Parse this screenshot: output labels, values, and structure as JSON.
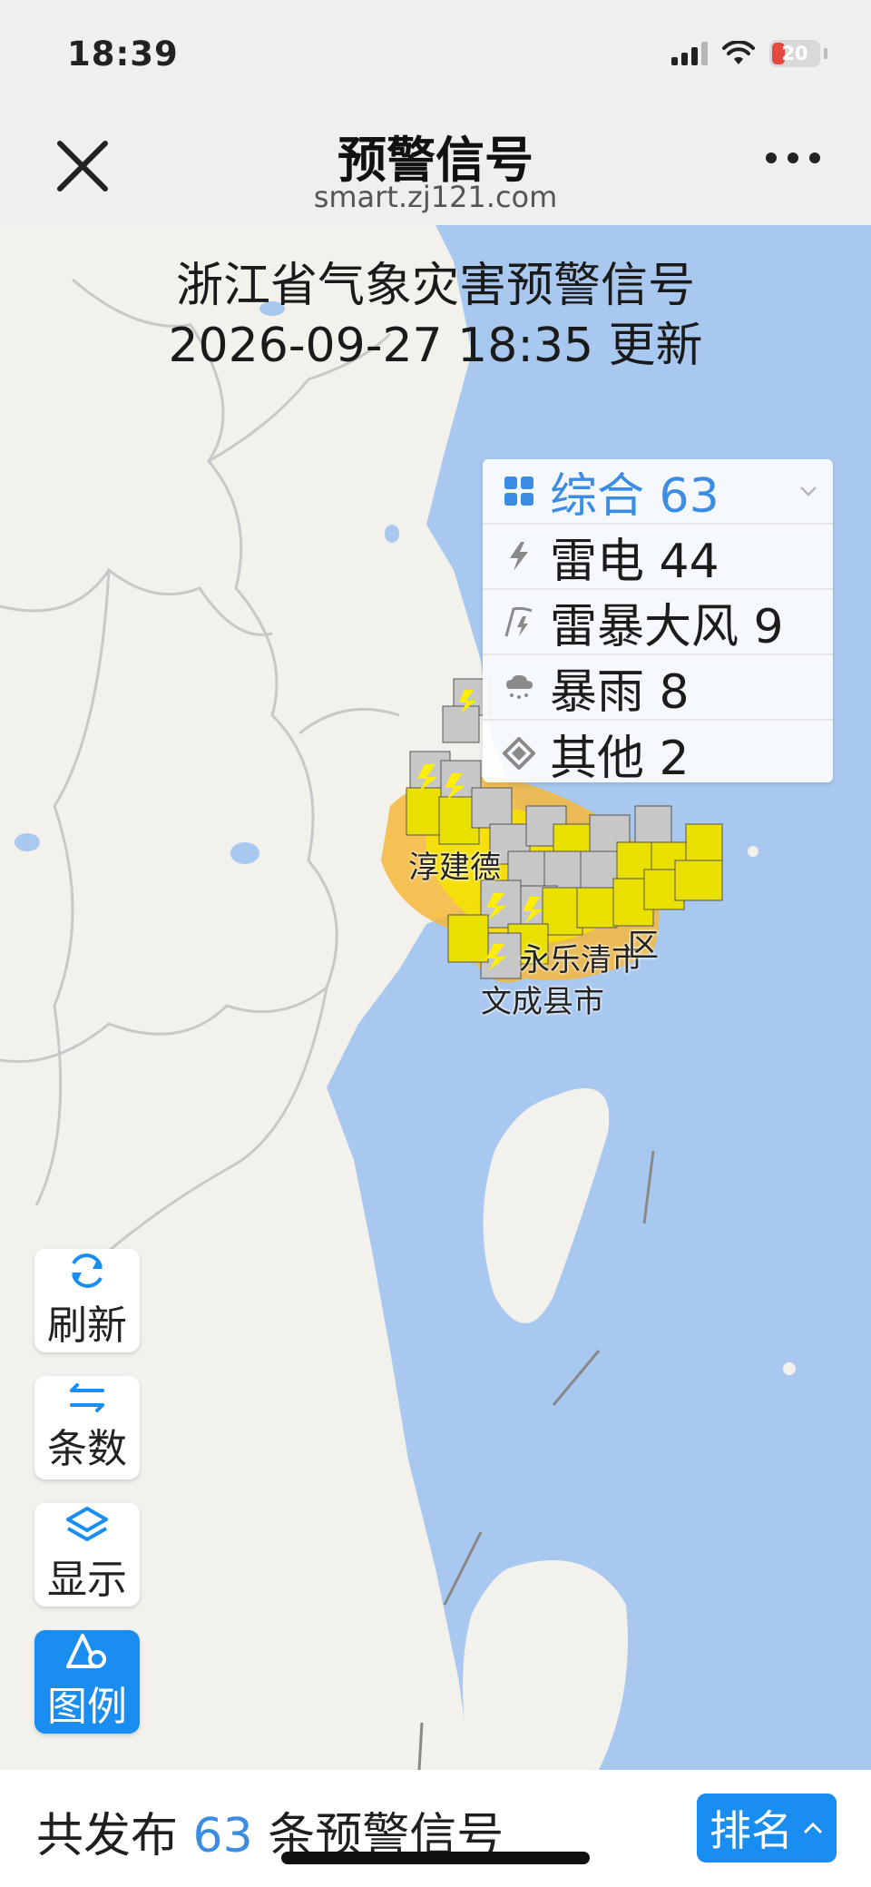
{
  "status_bar": {
    "time": "18:39",
    "battery": "20"
  },
  "nav": {
    "title": "预警信号",
    "subtitle": "smart.zj121.com"
  },
  "map": {
    "title_line1": "浙江省气象灾害预警信号",
    "title_line2": "2026-09-27 18:35 更新",
    "places": [
      "淳建德",
      "永乐清市",
      "文成县市",
      "区"
    ],
    "colors": {
      "land": "#f3f1ec",
      "sea": "#a9c8ef",
      "border": "#c8c8c8",
      "warning_yellow": "#f5e400",
      "warning_orange": "#f4b73a"
    }
  },
  "warning_types": [
    {
      "icon": "grid-icon",
      "label": "综合 63",
      "active": true
    },
    {
      "icon": "lightning-icon",
      "label": "雷电 44"
    },
    {
      "icon": "thunder-wind-icon",
      "label": "雷暴大风 9"
    },
    {
      "icon": "rain-cloud-icon",
      "label": "暴雨 8"
    },
    {
      "icon": "diamond-icon",
      "label": "其他 2"
    }
  ],
  "side_buttons": {
    "refresh": "刷新",
    "count": "条数",
    "display": "显示",
    "legend": "图例"
  },
  "bottom": {
    "prefix": "共发布",
    "count": "63",
    "suffix": "条预警信号",
    "rank_label": "排名"
  }
}
